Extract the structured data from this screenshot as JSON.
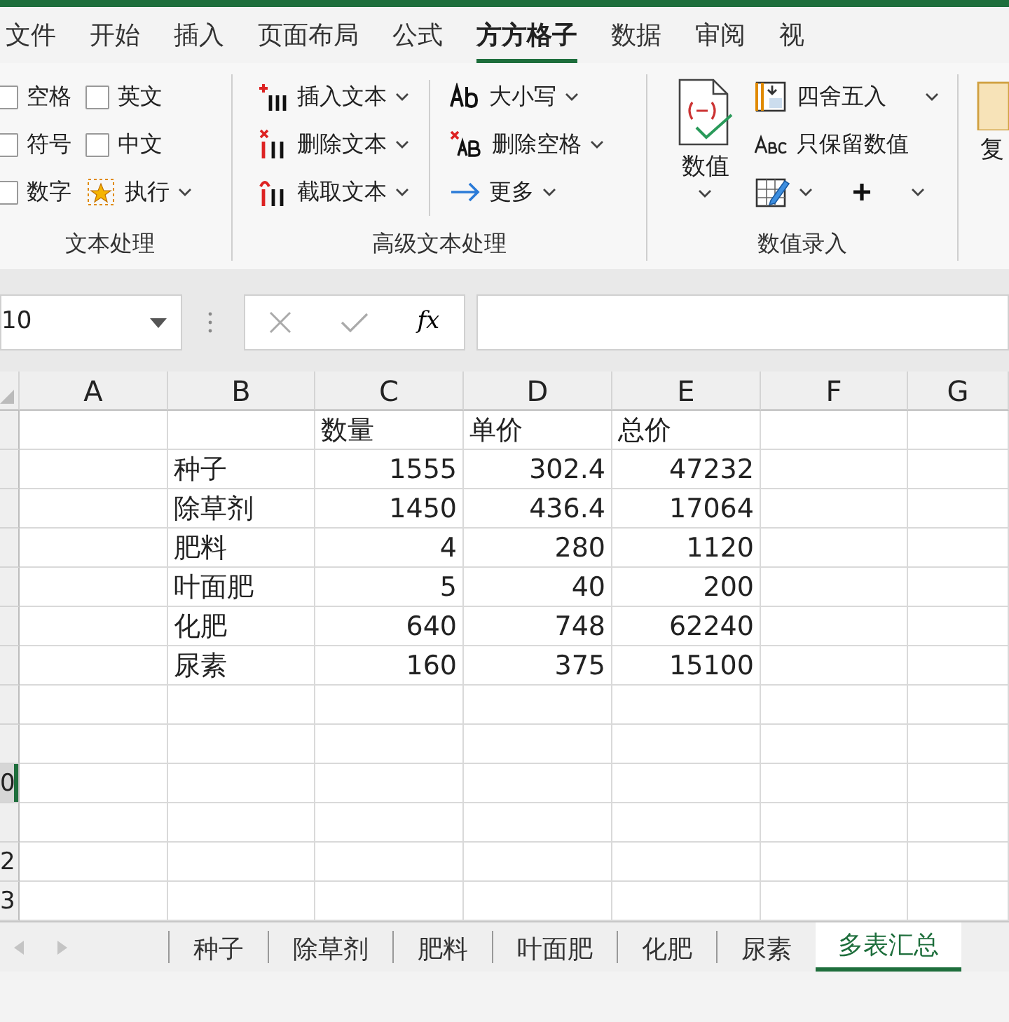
{
  "tabs": [
    {
      "label": "文件",
      "selected": false
    },
    {
      "label": "开始",
      "selected": false
    },
    {
      "label": "插入",
      "selected": false
    },
    {
      "label": "页面布局",
      "selected": false
    },
    {
      "label": "公式",
      "selected": false
    },
    {
      "label": "方方格子",
      "selected": true
    },
    {
      "label": "数据",
      "selected": false
    },
    {
      "label": "审阅",
      "selected": false
    },
    {
      "label": "视",
      "selected": false
    }
  ],
  "ribbon": {
    "text_group": {
      "label": "文本处理",
      "checkboxes": [
        {
          "label": "空格",
          "checked": false
        },
        {
          "label": "符号",
          "checked": false
        },
        {
          "label": "数字",
          "checked": false
        },
        {
          "label": "英文",
          "checked": false
        },
        {
          "label": "中文",
          "checked": false
        }
      ],
      "run_button": "执行"
    },
    "advanced_group": {
      "label": "高级文本处理",
      "commands": [
        {
          "label": "插入文本",
          "kind": "insert"
        },
        {
          "label": "删除文本",
          "kind": "delete"
        },
        {
          "label": "截取文本",
          "kind": "extract"
        },
        {
          "label": "大小写",
          "kind": "case"
        },
        {
          "label": "删除空格",
          "kind": "trim"
        },
        {
          "label": "更多",
          "kind": "more"
        }
      ]
    },
    "number_group": {
      "label": "数值录入",
      "big_button": "数值",
      "commands": [
        {
          "label": "四舍五入",
          "kind": "round"
        },
        {
          "label": "只保留数值",
          "kind": "keep"
        }
      ]
    },
    "cut_button": "复"
  },
  "formula_bar": {
    "name_box": "10",
    "function_label": "fx"
  },
  "sheet": {
    "columns": [
      "A",
      "B",
      "C",
      "D",
      "E",
      "F",
      "G"
    ],
    "rows": [
      {
        "kind": "header",
        "selected": false,
        "cells": [
          null,
          null,
          "数量",
          "单价",
          "总价",
          null,
          null
        ]
      },
      {
        "kind": "data",
        "selected": false,
        "cells": [
          null,
          "种子",
          "1555",
          "302.4",
          "47232",
          null,
          null
        ]
      },
      {
        "kind": "data",
        "selected": false,
        "cells": [
          null,
          "除草剂",
          "1450",
          "436.4",
          "17064",
          null,
          null
        ]
      },
      {
        "kind": "data",
        "selected": false,
        "cells": [
          null,
          "肥料",
          "4",
          "280",
          "1120",
          null,
          null
        ]
      },
      {
        "kind": "data",
        "selected": false,
        "cells": [
          null,
          "叶面肥",
          "5",
          "40",
          "200",
          null,
          null
        ]
      },
      {
        "kind": "data",
        "selected": false,
        "cells": [
          null,
          "化肥",
          "640",
          "748",
          "62240",
          null,
          null
        ]
      },
      {
        "kind": "data",
        "selected": false,
        "cells": [
          null,
          "尿素",
          "160",
          "375",
          "15100",
          null,
          null
        ]
      },
      {
        "kind": "empty",
        "selected": false
      },
      {
        "kind": "empty",
        "selected": false
      },
      {
        "kind": "empty",
        "selected": true,
        "row_label": "0"
      },
      {
        "kind": "empty",
        "selected": false
      },
      {
        "kind": "empty",
        "selected": false,
        "row_label": "2"
      },
      {
        "kind": "empty",
        "selected": false,
        "row_label": "3"
      }
    ]
  },
  "sheet_tabs": [
    {
      "label": "种子",
      "selected": false
    },
    {
      "label": "除草剂",
      "selected": false
    },
    {
      "label": "肥料",
      "selected": false
    },
    {
      "label": "叶面肥",
      "selected": false
    },
    {
      "label": "化肥",
      "selected": false
    },
    {
      "label": "尿素",
      "selected": false
    },
    {
      "label": "多表汇总",
      "selected": true
    }
  ]
}
